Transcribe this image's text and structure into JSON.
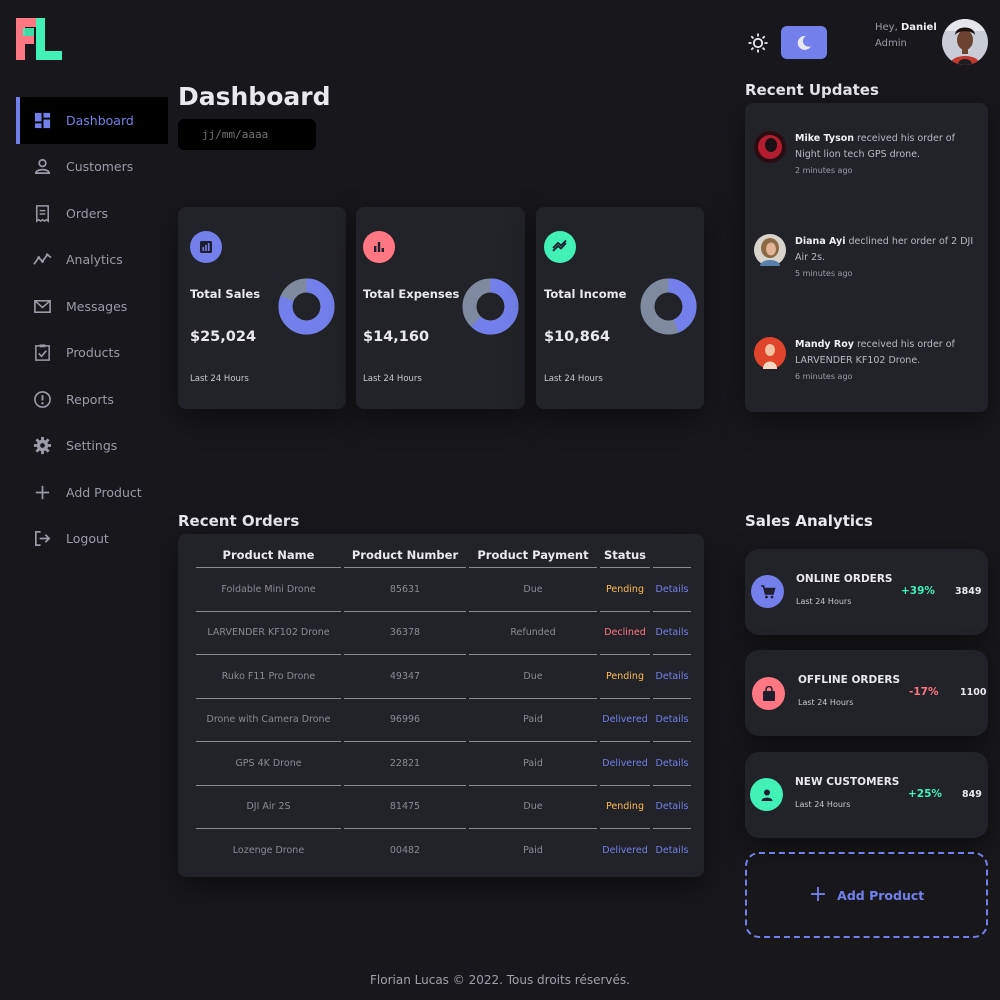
{
  "sidebar": {
    "items": [
      {
        "label": "Dashboard",
        "icon": "dashboard-icon"
      },
      {
        "label": "Customers",
        "icon": "person-icon"
      },
      {
        "label": "Orders",
        "icon": "receipt-icon"
      },
      {
        "label": "Analytics",
        "icon": "analytics-icon"
      },
      {
        "label": "Messages",
        "icon": "mail-icon"
      },
      {
        "label": "Products",
        "icon": "clipboard-icon"
      },
      {
        "label": "Reports",
        "icon": "report-icon"
      },
      {
        "label": "Settings",
        "icon": "gear-icon"
      },
      {
        "label": "Add Product",
        "icon": "plus-icon"
      },
      {
        "label": "Logout",
        "icon": "logout-icon"
      }
    ]
  },
  "header": {
    "title": "Dashboard",
    "date_placeholder": "jj/mm/aaaa"
  },
  "profile": {
    "greeting": "Hey, ",
    "name": "Daniel",
    "role": "Admin"
  },
  "stats": [
    {
      "title": "Total Sales",
      "value": "$25,024",
      "note": "Last 24 Hours",
      "icon_color": "#7380ec",
      "icon": "bar-chart-icon",
      "fraction": 0.81
    },
    {
      "title": "Total Expenses",
      "value": "$14,160",
      "note": "Last 24 Hours",
      "icon_color": "#ff7782",
      "icon": "bar-graph-icon",
      "fraction": 0.62
    },
    {
      "title": "Total Income",
      "value": "$10,864",
      "note": "Last 24 Hours",
      "icon_color": "#41f1b6",
      "icon": "trend-icon",
      "fraction": 0.44
    }
  ],
  "recent_updates": {
    "title": "Recent Updates",
    "items": [
      {
        "name": "Mike Tyson",
        "text": " received his order of Night lion tech GPS drone.",
        "time": "2 minutes ago"
      },
      {
        "name": "Diana Ayi",
        "text": " declined her order of 2 DJI Air 2s.",
        "time": "5 minutes ago"
      },
      {
        "name": "Mandy Roy",
        "text": " received his order of LARVENDER KF102 Drone.",
        "time": "6 minutes ago"
      }
    ]
  },
  "recent_orders": {
    "title": "Recent Orders",
    "columns": [
      "Product Name",
      "Product Number",
      "Product Payment",
      "Status"
    ],
    "rows": [
      {
        "name": "Foldable Mini Drone",
        "number": "85631",
        "payment": "Due",
        "status": "Pending",
        "status_kind": "pending",
        "action": "Details"
      },
      {
        "name": "LARVENDER KF102 Drone",
        "number": "36378",
        "payment": "Refunded",
        "status": "Declined",
        "status_kind": "declined",
        "action": "Details"
      },
      {
        "name": "Ruko F11 Pro Drone",
        "number": "49347",
        "payment": "Due",
        "status": "Pending",
        "status_kind": "pending",
        "action": "Details"
      },
      {
        "name": "Drone with Camera Drone",
        "number": "96996",
        "payment": "Paid",
        "status": "Delivered",
        "status_kind": "delivered",
        "action": "Details"
      },
      {
        "name": "GPS 4K Drone",
        "number": "22821",
        "payment": "Paid",
        "status": "Delivered",
        "status_kind": "delivered",
        "action": "Details"
      },
      {
        "name": "DJI Air 2S",
        "number": "81475",
        "payment": "Due",
        "status": "Pending",
        "status_kind": "pending",
        "action": "Details"
      },
      {
        "name": "Lozenge Drone",
        "number": "00482",
        "payment": "Paid",
        "status": "Delivered",
        "status_kind": "delivered",
        "action": "Details"
      }
    ]
  },
  "sales_analytics": {
    "title": "Sales Analytics",
    "items": [
      {
        "title": "ONLINE ORDERS",
        "sub": "Last 24 Hours",
        "pct": "+39%",
        "count": "3849",
        "color": "#7380ec",
        "pct_color": "#41f1b6",
        "icon": "cart-icon"
      },
      {
        "title": "OFFLINE ORDERS",
        "sub": "Last 24 Hours",
        "pct": "-17%",
        "count": "1100",
        "color": "#ff7782",
        "pct_color": "#ff7782",
        "icon": "bag-icon"
      },
      {
        "title": "NEW CUSTOMERS",
        "sub": "Last 24 Hours",
        "pct": "+25%",
        "count": "849",
        "color": "#41f1b6",
        "pct_color": "#41f1b6",
        "icon": "person-icon"
      }
    ],
    "add_label": "Add Product"
  },
  "footer": "Florian Lucas © 2022. Tous droits réservés.",
  "colors": {
    "primary": "#7380ec",
    "danger": "#ff7782",
    "success": "#41f1b6",
    "warning": "#ffbb55",
    "bg": "#18181c",
    "card": "#222328"
  }
}
